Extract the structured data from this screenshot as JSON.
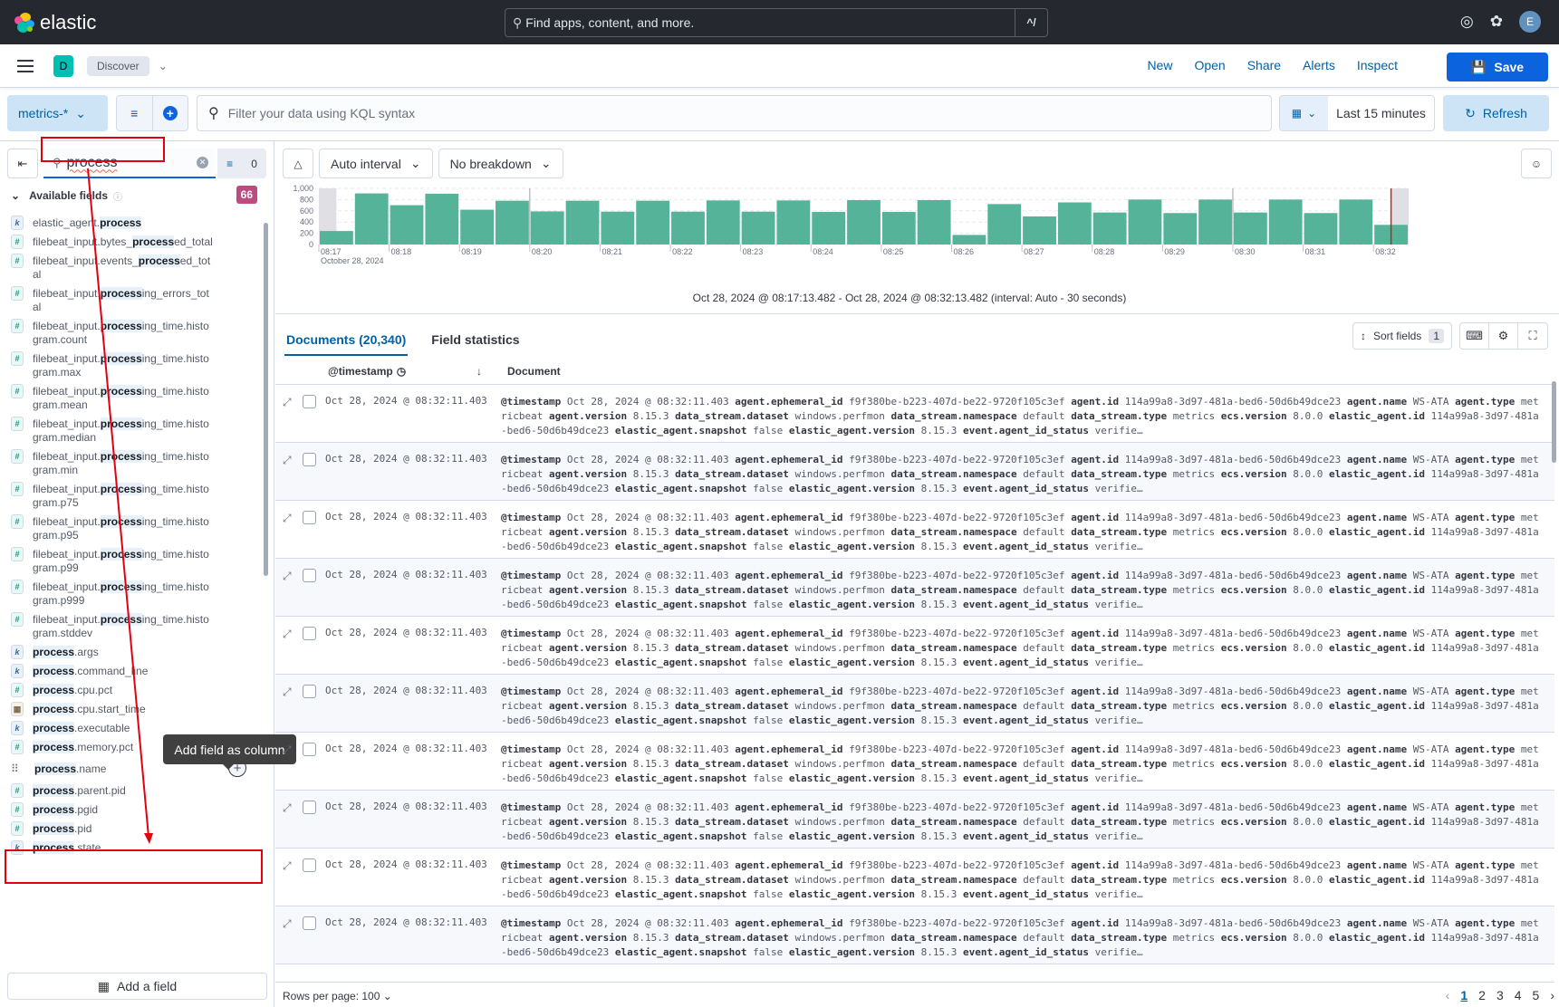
{
  "header": {
    "brand": "elastic",
    "global_search_placeholder": "Find apps, content, and more.",
    "global_search_shortcut": "^/",
    "avatar_initial": "E"
  },
  "nav": {
    "space_initial": "D",
    "breadcrumb": "Discover",
    "links": [
      "New",
      "Open",
      "Share",
      "Alerts",
      "Inspect"
    ],
    "save_label": "Save"
  },
  "query": {
    "data_view": "metrics-*",
    "kql_placeholder": "Filter your data using KQL syntax",
    "time_range": "Last 15 minutes",
    "refresh_label": "Refresh"
  },
  "sidebar": {
    "search_value": "process",
    "filter_count": "0",
    "section_title": "Available fields",
    "available_count": "66",
    "fields": [
      {
        "type": "k",
        "pre": "elastic_agent.",
        "hl": "process",
        "post": ""
      },
      {
        "type": "num",
        "pre": "filebeat_input.bytes_",
        "hl": "process",
        "post": "ed_total"
      },
      {
        "type": "num",
        "pre": "filebeat_input.events_",
        "hl": "process",
        "post": "ed_total"
      },
      {
        "type": "num",
        "pre": "filebeat_input.",
        "hl": "process",
        "post": "ing_errors_total"
      },
      {
        "type": "num",
        "pre": "filebeat_input.",
        "hl": "process",
        "post": "ing_time.histogram.count"
      },
      {
        "type": "num",
        "pre": "filebeat_input.",
        "hl": "process",
        "post": "ing_time.histogram.max"
      },
      {
        "type": "num",
        "pre": "filebeat_input.",
        "hl": "process",
        "post": "ing_time.histogram.mean"
      },
      {
        "type": "num",
        "pre": "filebeat_input.",
        "hl": "process",
        "post": "ing_time.histogram.median"
      },
      {
        "type": "num",
        "pre": "filebeat_input.",
        "hl": "process",
        "post": "ing_time.histogram.min"
      },
      {
        "type": "num",
        "pre": "filebeat_input.",
        "hl": "process",
        "post": "ing_time.histogram.p75"
      },
      {
        "type": "num",
        "pre": "filebeat_input.",
        "hl": "process",
        "post": "ing_time.histogram.p95"
      },
      {
        "type": "num",
        "pre": "filebeat_input.",
        "hl": "process",
        "post": "ing_time.histogram.p99"
      },
      {
        "type": "num",
        "pre": "filebeat_input.",
        "hl": "process",
        "post": "ing_time.histogram.p999"
      },
      {
        "type": "num",
        "pre": "filebeat_input.",
        "hl": "process",
        "post": "ing_time.histogram.stddev"
      },
      {
        "type": "k",
        "pre": "",
        "hl": "process",
        "post": ".args"
      },
      {
        "type": "k",
        "pre": "",
        "hl": "process",
        "post": ".command_line"
      },
      {
        "type": "num",
        "pre": "",
        "hl": "process",
        "post": ".cpu.pct"
      },
      {
        "type": "date",
        "pre": "",
        "hl": "process",
        "post": ".cpu.start_time"
      },
      {
        "type": "k",
        "pre": "",
        "hl": "process",
        "post": ".executable"
      },
      {
        "type": "num",
        "pre": "",
        "hl": "process",
        "post": ".memory.pct"
      },
      {
        "type": "drag",
        "pre": "",
        "hl": "process",
        "post": ".name",
        "active": true
      },
      {
        "type": "num",
        "pre": "",
        "hl": "process",
        "post": ".parent.pid"
      },
      {
        "type": "num",
        "pre": "",
        "hl": "process",
        "post": ".pgid"
      },
      {
        "type": "num",
        "pre": "",
        "hl": "process",
        "post": ".pid"
      },
      {
        "type": "k",
        "pre": "",
        "hl": "process",
        "post": ".state"
      }
    ],
    "tooltip": "Add field as column",
    "add_field_label": "Add a field"
  },
  "histogram_controls": {
    "interval": "Auto interval",
    "breakdown": "No breakdown"
  },
  "chart_data": {
    "type": "bar",
    "title": "",
    "xlabel": "",
    "ylabel": "",
    "ylim": [
      0,
      1000
    ],
    "yticks": [
      "1,000",
      "800",
      "600",
      "400",
      "200",
      "0"
    ],
    "ytick_values": [
      1000,
      800,
      600,
      400,
      200,
      0
    ],
    "xtick_labels": [
      "08:17",
      "08:18",
      "08:19",
      "08:20",
      "08:21",
      "08:22",
      "08:23",
      "08:24",
      "08:25",
      "08:26",
      "08:27",
      "08:28",
      "08:29",
      "08:30",
      "08:31",
      "08:32"
    ],
    "date_label": "October 28, 2024",
    "interval": "30 seconds",
    "values": [
      240,
      910,
      700,
      905,
      620,
      780,
      590,
      780,
      585,
      780,
      585,
      785,
      585,
      785,
      580,
      790,
      580,
      790,
      170,
      720,
      500,
      750,
      570,
      800,
      560,
      800,
      570,
      800,
      560,
      800,
      350
    ],
    "color": "#54b399",
    "grid": true,
    "partial_buckets": [
      "first",
      "last"
    ],
    "now_marker_color": "#bd271e"
  },
  "time_range_label": "Oct 28, 2024 @ 08:17:13.482 - Oct 28, 2024 @ 08:32:13.482 (interval: Auto - 30 seconds)",
  "tabs": {
    "documents": "Documents (20,340)",
    "field_stats": "Field statistics"
  },
  "table": {
    "sort_label": "Sort fields",
    "sort_count": "1",
    "col_timestamp": "@timestamp",
    "col_document": "Document",
    "rows": [
      {
        "ts": "Oct 28, 2024 @ 08:32:11.403"
      },
      {
        "ts": "Oct 28, 2024 @ 08:32:11.403"
      },
      {
        "ts": "Oct 28, 2024 @ 08:32:11.403"
      },
      {
        "ts": "Oct 28, 2024 @ 08:32:11.403"
      },
      {
        "ts": "Oct 28, 2024 @ 08:32:11.403"
      },
      {
        "ts": "Oct 28, 2024 @ 08:32:11.403"
      },
      {
        "ts": "Oct 28, 2024 @ 08:32:11.403"
      },
      {
        "ts": "Oct 28, 2024 @ 08:32:11.403"
      },
      {
        "ts": "Oct 28, 2024 @ 08:32:11.403"
      },
      {
        "ts": "Oct 28, 2024 @ 08:32:11.403"
      }
    ],
    "doc_pairs": [
      [
        "@timestamp",
        "Oct 28, 2024 @ 08:32:11.403"
      ],
      [
        "agent.ephemeral_id",
        "f9f380be-b223-407d-be22-9720f105c3ef"
      ],
      [
        "agent.id",
        "114a99a8-3d97-481a-bed6-50d6b49dce23"
      ],
      [
        "agent.name",
        "WS-ATA"
      ],
      [
        "agent.type",
        "metricbeat"
      ],
      [
        "agent.version",
        "8.15.3"
      ],
      [
        "data_stream.dataset",
        "windows.perfmon"
      ],
      [
        "data_stream.namespace",
        "default"
      ],
      [
        "data_stream.type",
        "metrics"
      ],
      [
        "ecs.version",
        "8.0.0"
      ],
      [
        "elastic_agent.id",
        "114a99a8-3d97-481a-bed6-50d6b49dce23"
      ],
      [
        "elastic_agent.snapshot",
        "false"
      ],
      [
        "elastic_agent.version",
        "8.15.3"
      ],
      [
        "event.agent_id_status",
        "verifie…"
      ]
    ]
  },
  "footer": {
    "rows_per_page": "Rows per page: 100",
    "pages": [
      "1",
      "2",
      "3",
      "4",
      "5"
    ],
    "current_page": "1"
  }
}
